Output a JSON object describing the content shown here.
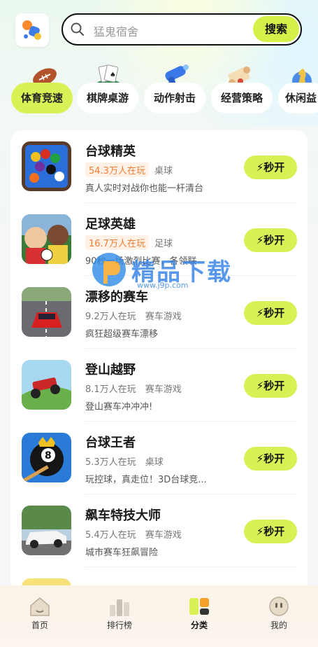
{
  "search": {
    "placeholder": "猛鬼宿舍",
    "button": "搜索"
  },
  "categories": [
    {
      "label": "体育竞速",
      "icon": "rugby-ball-icon",
      "active": true
    },
    {
      "label": "棋牌桌游",
      "icon": "cards-icon",
      "active": false
    },
    {
      "label": "动作射击",
      "icon": "blaster-icon",
      "active": false
    },
    {
      "label": "经营策略",
      "icon": "scroll-icon",
      "active": false
    },
    {
      "label": "休闲益",
      "icon": "chess-icon",
      "active": false
    }
  ],
  "games": [
    {
      "name": "台球精英",
      "players": "54.3万人在玩",
      "hot": true,
      "genre": "桌球",
      "desc": "真人实时对战你也能一杆清台",
      "play": "秒开"
    },
    {
      "name": "足球英雄",
      "players": "16.7万人在玩",
      "hot": true,
      "genre": "足球",
      "desc": "90秒一场激烈比赛，各领联",
      "play": "秒开"
    },
    {
      "name": "漂移的赛车",
      "players": "9.2万人在玩",
      "hot": false,
      "genre": "赛车游戏",
      "desc": "疯狂超级赛车漂移",
      "play": "秒开"
    },
    {
      "name": "登山越野",
      "players": "8.1万人在玩",
      "hot": false,
      "genre": "赛车游戏",
      "desc": "登山赛车冲冲冲!",
      "play": "秒开"
    },
    {
      "name": "台球王者",
      "players": "5.3万人在玩",
      "hot": false,
      "genre": "桌球",
      "desc": "玩控球，真走位！3D台球竞...",
      "play": "秒开"
    },
    {
      "name": "飙车特技大师",
      "players": "5.4万人在玩",
      "hot": false,
      "genre": "赛车游戏",
      "desc": "城市赛车狂飙冒险",
      "play": "秒开"
    }
  ],
  "watermark": {
    "text": "精品下载",
    "url": "www.j9p.com"
  },
  "tabs": [
    {
      "label": "首页",
      "icon": "home-icon",
      "active": false
    },
    {
      "label": "排行榜",
      "icon": "ranking-icon",
      "active": false
    },
    {
      "label": "分类",
      "icon": "category-icon",
      "active": true
    },
    {
      "label": "我的",
      "icon": "profile-icon",
      "active": false
    }
  ],
  "colors": {
    "accent": "#d9f155",
    "hot_tag_text": "#f07d33",
    "hot_tag_bg": "#fff1e6"
  }
}
